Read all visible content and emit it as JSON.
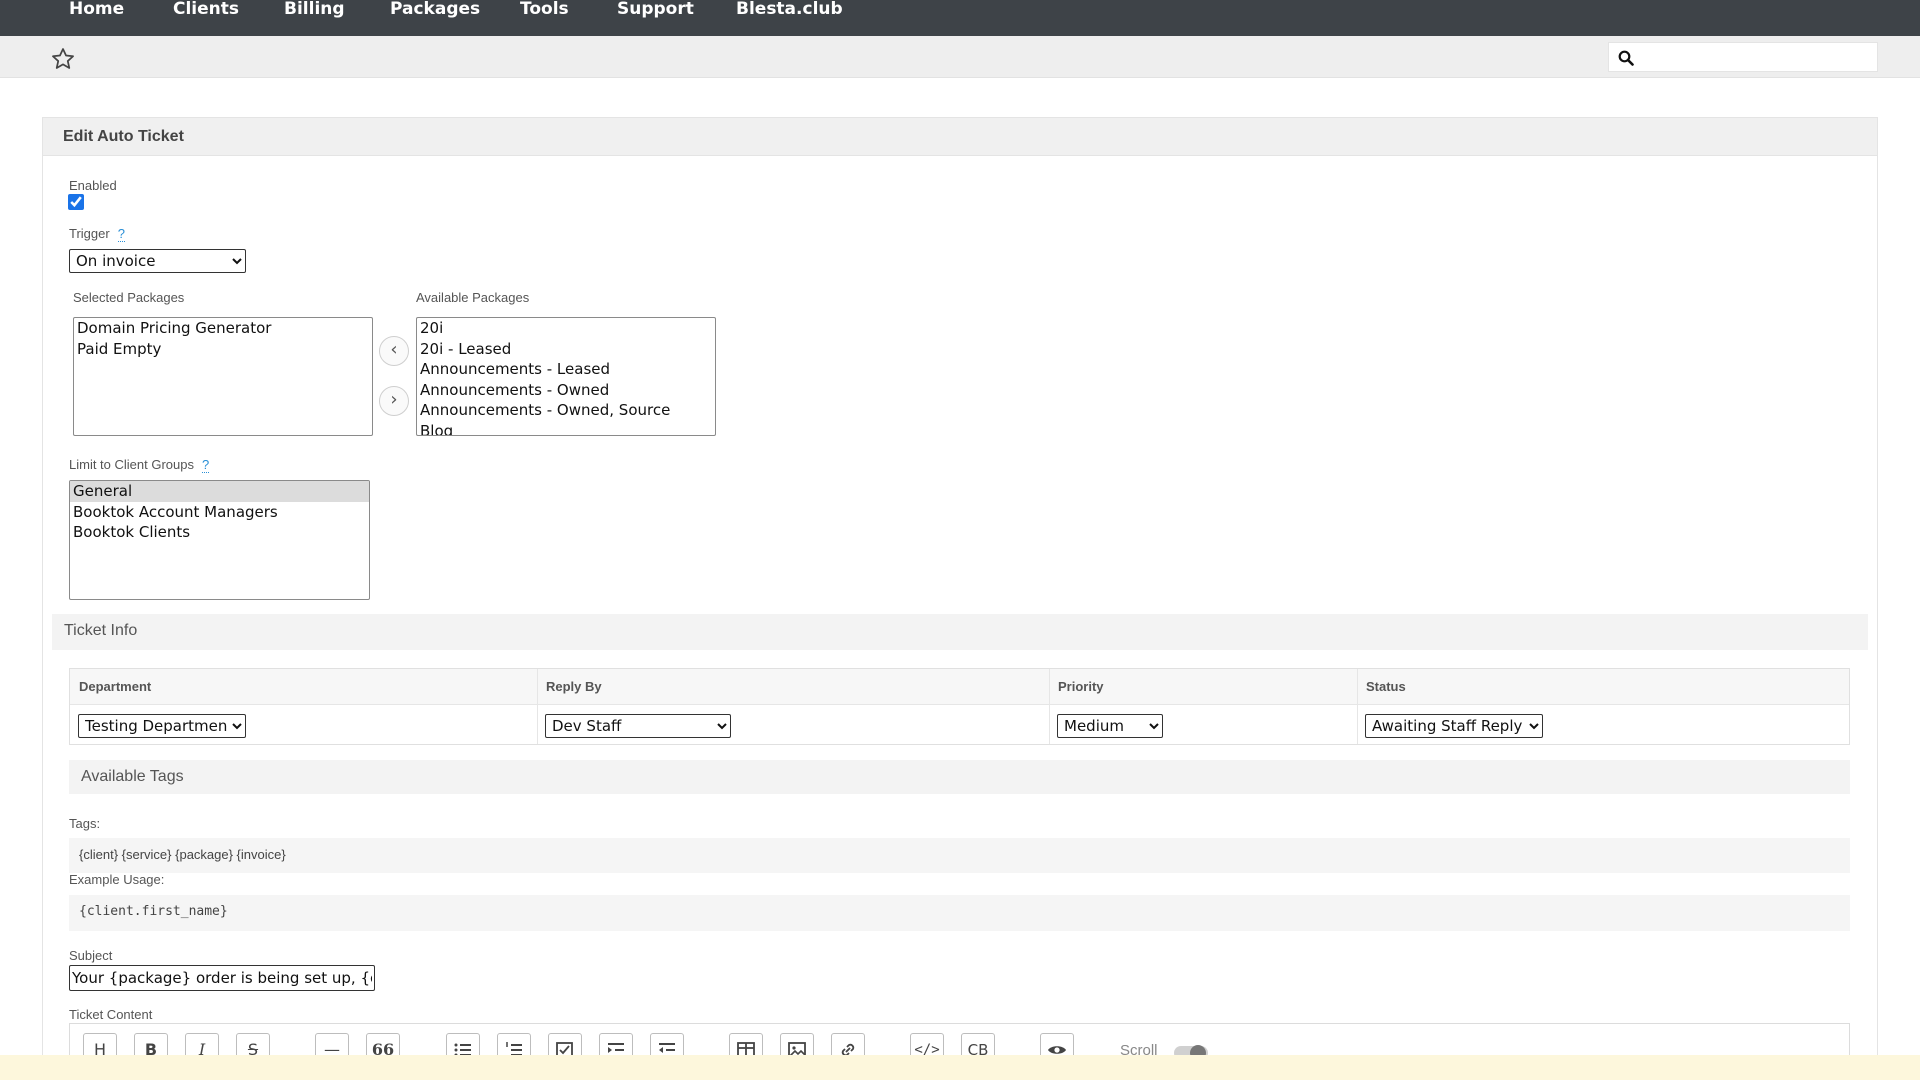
{
  "nav": {
    "items": [
      "Home",
      "Clients",
      "Billing",
      "Packages",
      "Tools",
      "Support",
      "Blesta.club"
    ]
  },
  "search": {
    "value": "",
    "placeholder": ""
  },
  "icons": {
    "favorite": "star-icon",
    "search": "search-icon"
  },
  "form": {
    "title": "Edit Auto Ticket",
    "enabled_label": "Enabled",
    "enabled": true,
    "trigger_label": "Trigger",
    "help_glyph": "?",
    "trigger_value": "On invoice",
    "selected_packages_label": "Selected Packages",
    "selected_packages": [
      "Domain Pricing Generator",
      "Paid Empty"
    ],
    "available_packages_label": "Available Packages",
    "available_packages": [
      "20i",
      "20i - Leased",
      "Announcements - Leased",
      "Announcements - Owned",
      "Announcements - Owned, Source",
      "Blog"
    ],
    "move_left_glyph": "‹",
    "move_right_glyph": "›",
    "client_groups_label": "Limit to Client Groups",
    "client_groups": [
      "General",
      "Booktok Account Managers",
      "Booktok Clients"
    ],
    "client_groups_selected": "General"
  },
  "ticket_info": {
    "title": "Ticket Info",
    "columns": [
      "Department",
      "Reply By",
      "Priority",
      "Status"
    ],
    "department": "Testing Department",
    "reply_by": "Dev Staff",
    "priority": "Medium",
    "status": "Awaiting Staff Reply"
  },
  "tags": {
    "title": "Available Tags",
    "tags_label": "Tags:",
    "tags_value": "{client} {service} {package} {invoice}",
    "example_label": "Example Usage:",
    "example_value": "{client.first_name}"
  },
  "subject": {
    "label": "Subject",
    "value": "Your {package} order is being set up, {client.first_name}"
  },
  "content": {
    "label": "Ticket Content",
    "toolbar": [
      "H",
      "B",
      "I",
      "S",
      "—",
      "66",
      "ul",
      "ol",
      "check",
      "indent",
      "outdent",
      "table",
      "image",
      "link",
      "code",
      "CB",
      "preview"
    ],
    "scroll_label": "Scroll"
  },
  "colors": {
    "nav_bg": "#3e4348",
    "accent": "#2a8fd6",
    "footer_bg": "#fdf7dc"
  }
}
